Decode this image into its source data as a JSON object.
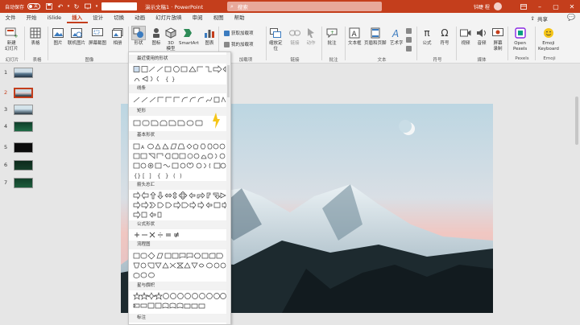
{
  "title_bar": {
    "autosave_label": "自动保存",
    "autosave_state": "关",
    "doc_title": "演示文稿1 · PowerPoint",
    "search_placeholder": "搜索",
    "user_name": "钭睫 程",
    "accent_color": "#c43e1c"
  },
  "tabs": [
    "文件",
    "开始",
    "iSlide",
    "插入",
    "设计",
    "切换",
    "动画",
    "幻灯片放映",
    "审阅",
    "视图",
    "帮助"
  ],
  "active_tab": "插入",
  "share_label": "共享",
  "ribbon": {
    "buttons": {
      "new_slide": "新建\n幻灯片",
      "table": "表格",
      "picture": "图片",
      "online_picture": "联机图片",
      "screenshot": "屏幕截图",
      "album": "相册",
      "shapes": "形状",
      "icons": "图标",
      "model_3d": "3D\n模型",
      "smartart": "SmartArt",
      "chart": "图表",
      "get_addins": "获取加载项",
      "my_addins": "我的加载项",
      "zoom": "缩放定\n位",
      "link": "链接",
      "action": "动作",
      "comment": "批注",
      "textbox": "文本框",
      "header_footer": "页眉和页脚",
      "wordart": "艺术字",
      "formula": "公式",
      "symbol": "符号",
      "video": "视频",
      "audio": "音频",
      "screen_record": "屏幕\n录制",
      "open_pexels": "Open\nPexels",
      "emoji_keyboard": "Emoji\nKeyboard"
    },
    "groups": {
      "slides": "幻灯片",
      "tables": "表格",
      "images": "图像",
      "addins": "加载项",
      "links": "链接",
      "comments": "批注",
      "text": "文本",
      "symbols": "符号",
      "media": "媒体",
      "pexels": "Pexels",
      "emoji": "Emoji"
    }
  },
  "thumbnails": [
    "1",
    "2",
    "3",
    "4",
    "5",
    "6",
    "7"
  ],
  "selected_slide": "2",
  "shapes_menu": {
    "sections": [
      "最近使用的形状",
      "线条",
      "矩形",
      "基本形状",
      "箭头总汇",
      "公式形状",
      "流程图",
      "星与旗帜",
      "标注"
    ]
  }
}
